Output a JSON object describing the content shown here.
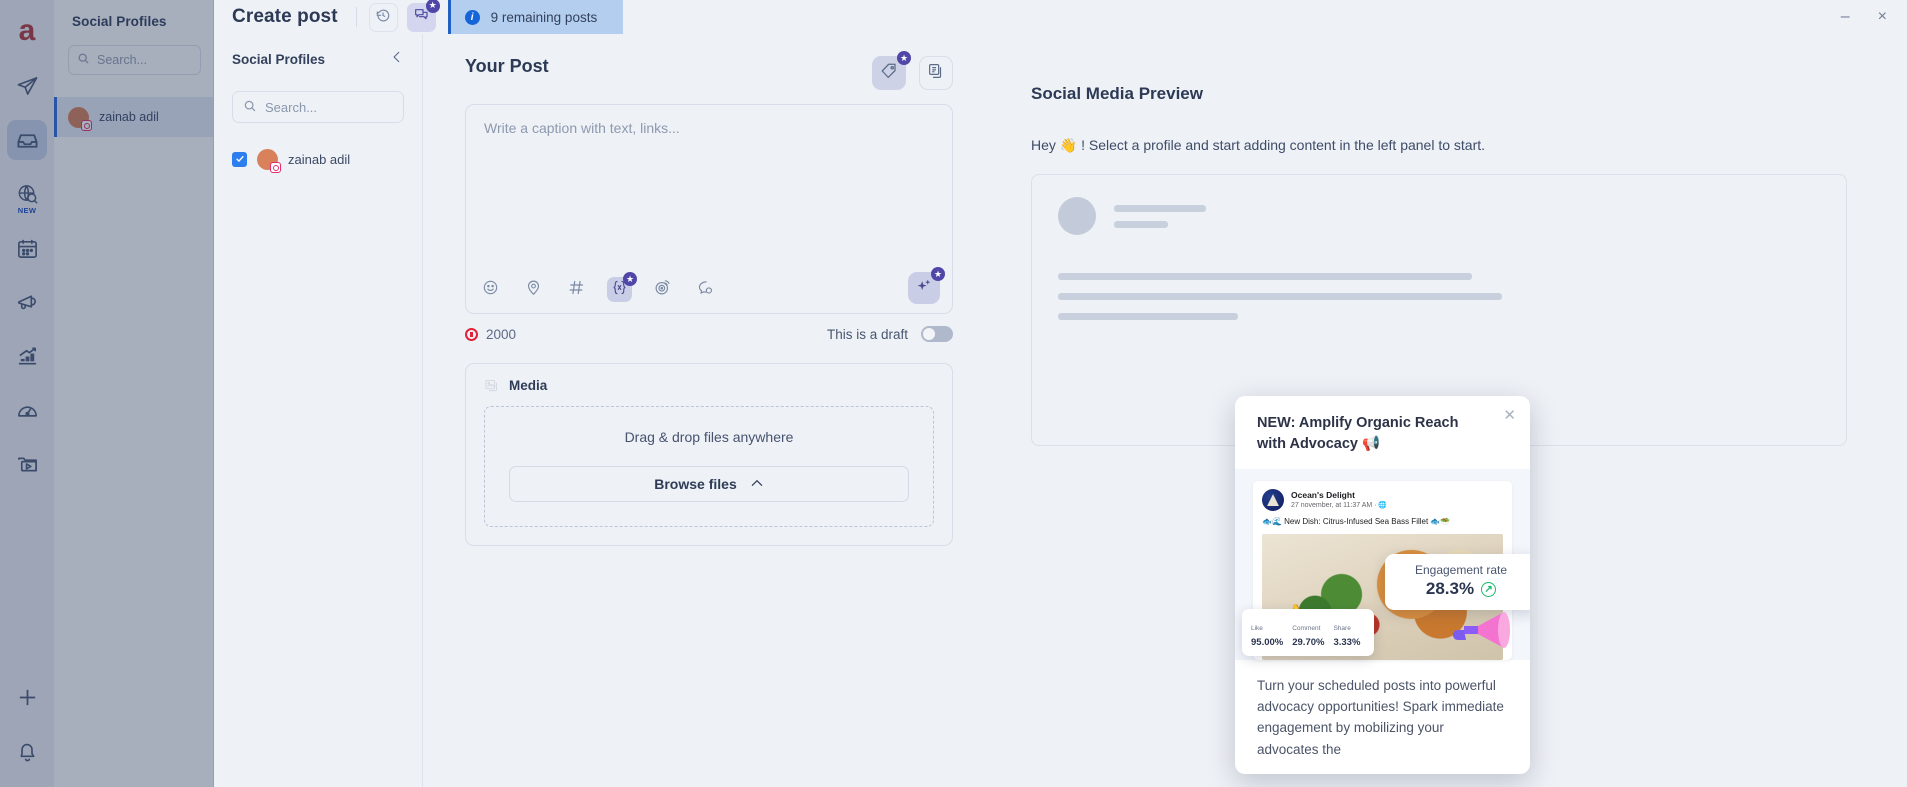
{
  "rail": {
    "logo": "a",
    "items": [
      {
        "name": "publish-icon",
        "label": "Publish"
      },
      {
        "name": "inbox-icon",
        "label": "Inbox",
        "active": true
      },
      {
        "name": "listening-icon",
        "label": "Listening",
        "badge": "NEW"
      },
      {
        "name": "calendar-icon",
        "label": "Calendar"
      },
      {
        "name": "ads-icon",
        "label": "Ads"
      },
      {
        "name": "analytics-icon",
        "label": "Analytics"
      },
      {
        "name": "dashboard-icon",
        "label": "Dashboard"
      },
      {
        "name": "media-library-icon",
        "label": "Media Library"
      }
    ],
    "bottom": [
      {
        "name": "add-icon",
        "label": "Add"
      },
      {
        "name": "notification-icon",
        "label": "Notifications"
      }
    ]
  },
  "background_panel": {
    "title": "Social Profiles",
    "search_placeholder": "Search...",
    "profile_name": "zainab adil"
  },
  "header": {
    "title": "Create post",
    "undo_icon": "history-icon",
    "comments_icon": "comments-icon",
    "remaining_text": "9 remaining posts",
    "info_icon": "info-icon",
    "minimize_label": "–",
    "close_label": "×"
  },
  "profiles_panel": {
    "title": "Social Profiles",
    "collapse_icon": "chevron-left-icon",
    "search_placeholder": "Search...",
    "profile": {
      "name": "zainab adil",
      "checked": true
    }
  },
  "post": {
    "title": "Your Post",
    "actions": [
      {
        "name": "tag-button",
        "icon": "tag-icon",
        "badge": "star"
      },
      {
        "name": "duplicate-button",
        "icon": "copy-icon"
      }
    ],
    "editor_placeholder": "Write a caption with text, links...",
    "tools": [
      {
        "name": "emoji-button",
        "icon": "emoji-icon"
      },
      {
        "name": "location-button",
        "icon": "location-pin-icon"
      },
      {
        "name": "hashtag-button",
        "icon": "hashtag-icon"
      },
      {
        "name": "variable-button",
        "icon": "variable-icon",
        "selected": true,
        "badge": "star"
      },
      {
        "name": "goal-button",
        "icon": "target-icon"
      },
      {
        "name": "first-comment-button",
        "icon": "chat-bubble-icon"
      }
    ],
    "ai_button": {
      "name": "ai-assist-button",
      "icon": "sparkles-icon",
      "badge": "star"
    },
    "char_count": "2000",
    "draft_label": "This is a draft",
    "draft_on": false
  },
  "media": {
    "title": "Media",
    "icon": "image-icon",
    "dropzone_text": "Drag & drop files anywhere",
    "browse_label": "Browse files",
    "browse_icon": "chevron-up-icon"
  },
  "preview": {
    "title": "Social Media Preview",
    "hint": "Hey 👋 ! Select a profile and start adding content in the left panel to start."
  },
  "popup": {
    "title": "NEW: Amplify Organic Reach with Advocacy 📢",
    "close_icon": "close-icon",
    "fb_post": {
      "page_name": "Ocean's Delight",
      "meta": "27 november, at 11:37 AM · 🌐",
      "caption": "🐟🌊 New Dish: Citrus-Infused Sea Bass Fillet 🐟🥗"
    },
    "engagement": {
      "label": "Engagement rate",
      "value": "28.3%",
      "trend": "↗"
    },
    "stats": [
      {
        "label": "Like",
        "value": "95.00%"
      },
      {
        "label": "Comment",
        "value": "29.70%"
      },
      {
        "label": "Share",
        "value": "3.33%"
      }
    ],
    "body": "Turn your scheduled posts into powerful advocacy opportunities! Spark immediate engagement by mobilizing your advocates the"
  },
  "colors": {
    "accent": "#4f46a8",
    "info": "#1565d8",
    "checkbox": "#2d7ff0",
    "warning": "#e0213a",
    "success": "#17b96b"
  }
}
